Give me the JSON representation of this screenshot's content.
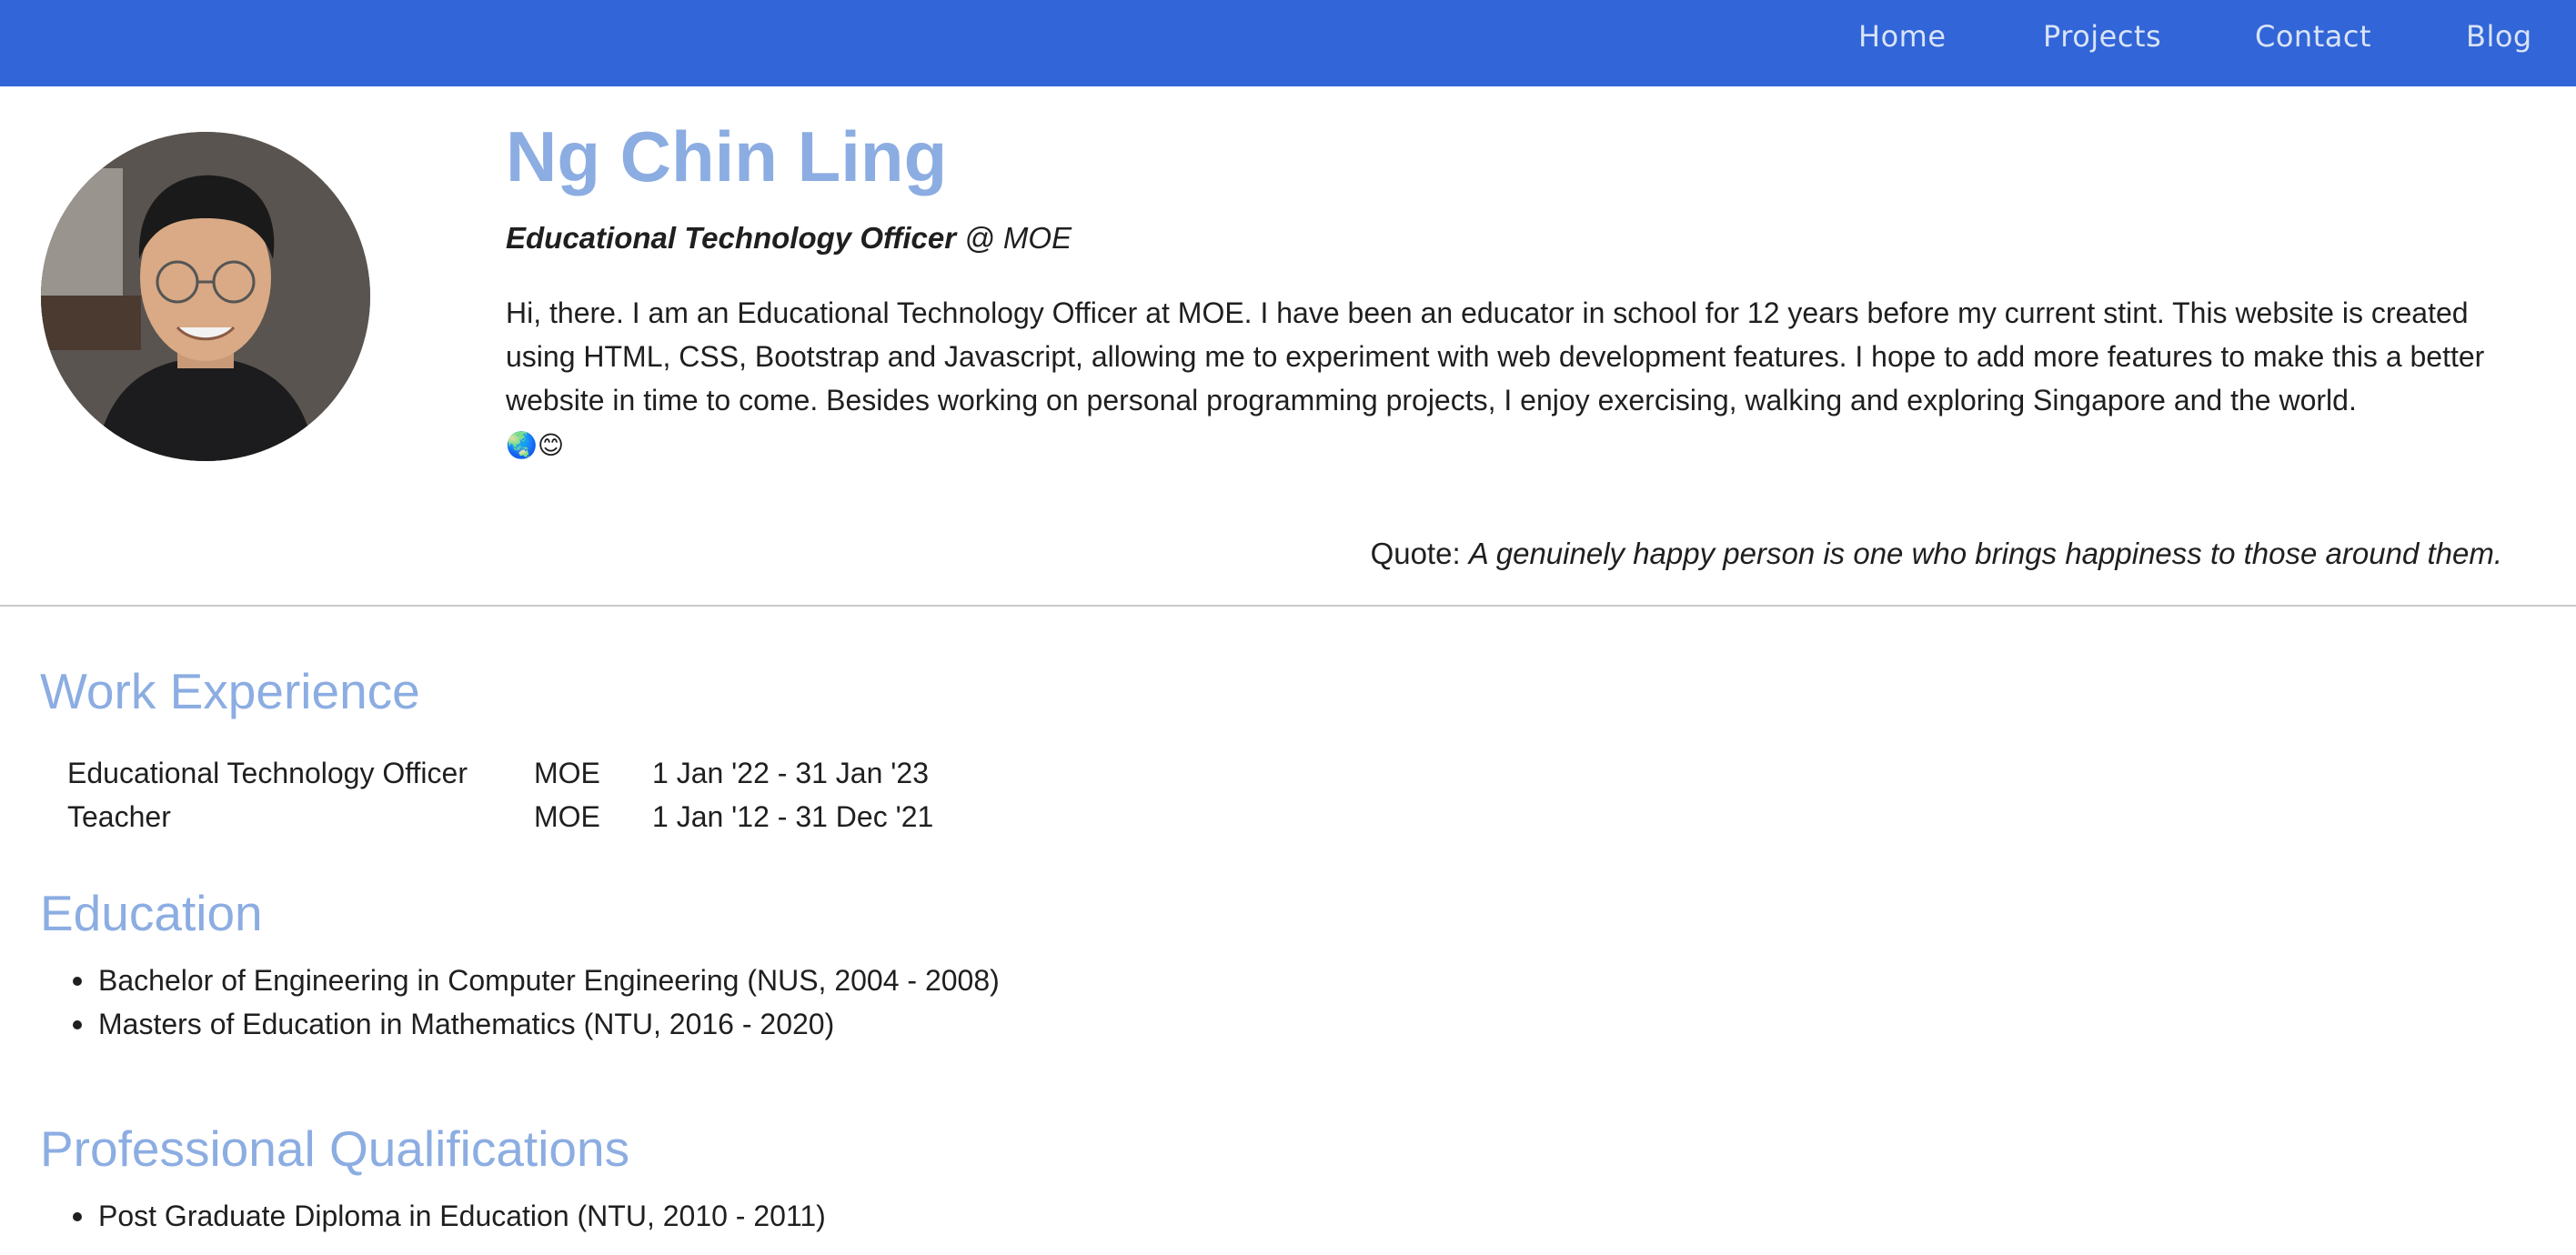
{
  "nav": {
    "links": [
      "Home",
      "Projects",
      "Contact",
      "Blog"
    ]
  },
  "profile": {
    "name": "Ng Chin Ling",
    "role_title": "Educational Technology Officer",
    "role_org": " @ MOE",
    "bio": "Hi, there. I am an Educational Technology Officer at MOE. I have been an educator in school for 12 years before my current stint. This website is created using HTML, CSS, Bootstrap and Javascript, allowing me to experiment with web development features. I hope to add more features to make this a better website in time to come. Besides working on personal programming projects, I enjoy exercising, walking and exploring Singapore and the world.",
    "bio_emoji": "🌏😊",
    "quote_label": "Quote: ",
    "quote_text": "A genuinely happy person is one who brings happiness to those around them."
  },
  "work": {
    "heading": "Work Experience",
    "rows": [
      {
        "role": "Educational Technology Officer",
        "org": "MOE",
        "period": "1 Jan '22 - 31 Jan '23"
      },
      {
        "role": "Teacher",
        "org": "MOE",
        "period": "1 Jan '12 - 31 Dec '21"
      }
    ]
  },
  "education": {
    "heading": "Education",
    "items": [
      "Bachelor of Engineering in Computer Engineering (NUS, 2004 - 2008)",
      "Masters of Education in Mathematics (NTU, 2016 - 2020)"
    ]
  },
  "qualifications": {
    "heading": "Professional Qualifications",
    "items": [
      "Post Graduate Diploma in Education (NTU, 2010 - 2011)"
    ]
  },
  "colors": {
    "navbar": "#3165d8",
    "heading": "#8cade2",
    "nav_text": "#d9e3f7"
  }
}
